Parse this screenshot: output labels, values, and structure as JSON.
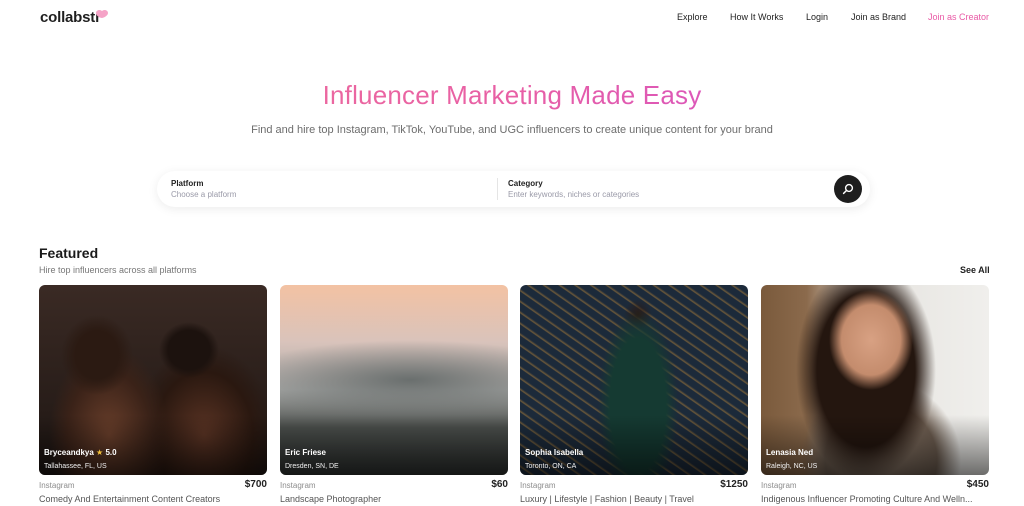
{
  "header": {
    "logo": "collabstr",
    "nav": [
      {
        "label": "Explore"
      },
      {
        "label": "How It Works"
      },
      {
        "label": "Login"
      },
      {
        "label": "Join as Brand"
      },
      {
        "label": "Join as Creator"
      }
    ]
  },
  "hero": {
    "title": "Influencer Marketing Made Easy",
    "subtitle": "Find and hire top Instagram, TikTok, YouTube, and UGC influencers to create unique content for your brand"
  },
  "search": {
    "platform_label": "Platform",
    "platform_placeholder": "Choose a platform",
    "category_label": "Category",
    "category_placeholder": "Enter keywords, niches or categories",
    "button_icon": "search-icon"
  },
  "featured": {
    "title": "Featured",
    "subtitle": "Hire top influencers across all platforms",
    "see_all": "See All",
    "cards": [
      {
        "name": "Bryceandkya",
        "rating": "5.0",
        "location": "Tallahassee, FL, US",
        "platform": "Instagram",
        "price": "$700",
        "description": "Comedy And Entertainment Content Creators"
      },
      {
        "name": "Eric Friese",
        "rating": "",
        "location": "Dresden, SN, DE",
        "platform": "Instagram",
        "price": "$60",
        "description": "Landscape Photographer"
      },
      {
        "name": "Sophia Isabella",
        "rating": "",
        "location": "Toronto, ON, CA",
        "platform": "Instagram",
        "price": "$1250",
        "description": "Luxury | Lifestyle | Fashion | Beauty | Travel"
      },
      {
        "name": "Lenasia Ned",
        "rating": "",
        "location": "Raleigh, NC, US",
        "platform": "Instagram",
        "price": "$450",
        "description": "Indigenous Influencer Promoting Culture And Welln..."
      }
    ]
  },
  "colors": {
    "accent_pink": "#e95aa6",
    "accent_purple": "#c84ad9"
  }
}
